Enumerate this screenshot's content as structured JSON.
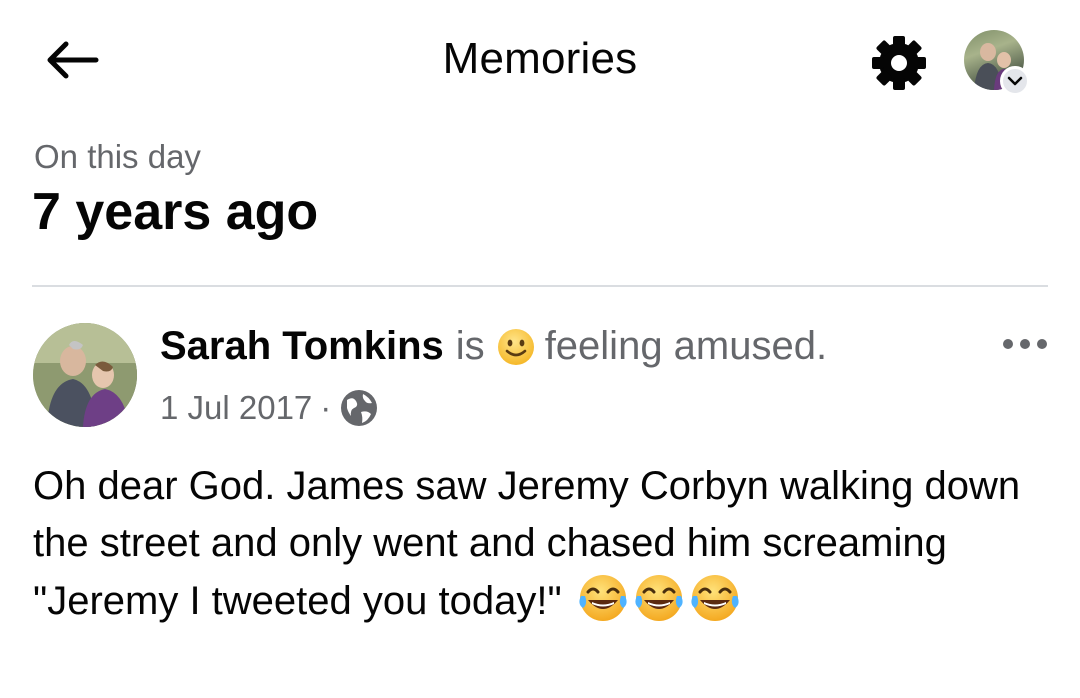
{
  "header": {
    "title": "Memories",
    "back_icon": "arrow-left-icon",
    "settings_icon": "gear-icon",
    "profile_chevron_icon": "chevron-down-icon"
  },
  "memory": {
    "subtitle": "On this day",
    "heading": "7 years ago"
  },
  "post": {
    "author": "Sarah Tomkins",
    "is_word": "is",
    "feeling_emoji": "slightly-smiling-face-emoji",
    "feeling_text": "feeling amused.",
    "date": "1 Jul 2017",
    "separator": "·",
    "privacy_icon": "globe-icon",
    "more_icon": "more-horizontal-icon",
    "text": "Oh dear God.  James saw Jeremy Corbyn walking down the street and only went and chased him screaming \"Jeremy I tweeted you today!\"",
    "trailing_emojis": [
      "face-with-tears-of-joy",
      "face-with-tears-of-joy",
      "face-with-tears-of-joy"
    ]
  },
  "colors": {
    "primary_text": "#050505",
    "secondary_text": "#65676b",
    "divider": "#dadde1",
    "background": "#ffffff"
  }
}
